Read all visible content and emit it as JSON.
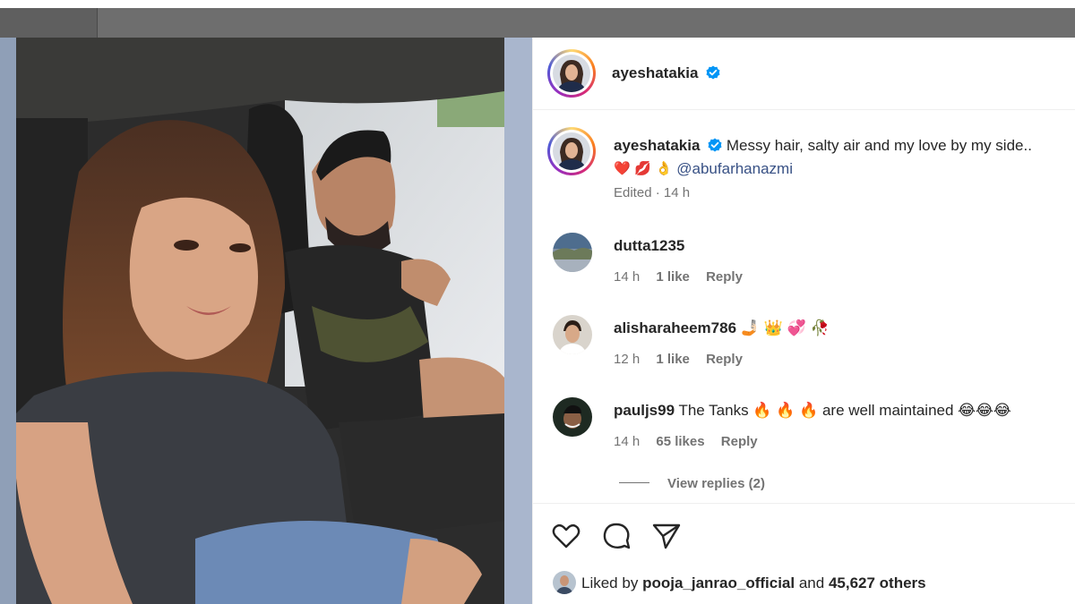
{
  "post": {
    "author": "ayeshatakia",
    "verified_icon": "verified-badge-icon",
    "caption_text": "Messy hair, salty air and my love by my side..",
    "caption_emojis": [
      "❤️",
      "💋",
      "👌"
    ],
    "mention": "@abufarhanazmi",
    "caption_meta": "Edited · 14 h"
  },
  "comments": [
    {
      "username": "dutta1235",
      "text": "",
      "time": "14 h",
      "likes": "1 like",
      "reply": "Reply"
    },
    {
      "username": "alisharaheem786",
      "text": "🤳🏻 👑 💞 🥀",
      "time": "12 h",
      "likes": "1 like",
      "reply": "Reply"
    },
    {
      "username": "pauljs99",
      "text": "The Tanks 🔥 🔥 🔥  are well maintained 😂😂😂",
      "time": "14 h",
      "likes": "65 likes",
      "reply": "Reply"
    }
  ],
  "view_replies": "View replies (2)",
  "actions": {
    "like_icon": "heart-icon",
    "comment_icon": "comment-icon",
    "share_icon": "share-icon"
  },
  "liked_by": {
    "prefix": "Liked by",
    "user": "pooja_janrao_official",
    "conjunction": "and",
    "others": "45,627 others"
  },
  "colors": {
    "accent_blue": "#0095f6",
    "link": "#385185",
    "muted": "#737373"
  }
}
